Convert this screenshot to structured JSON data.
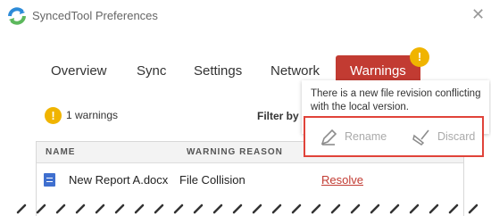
{
  "window": {
    "title": "SyncedTool Preferences",
    "close_glyph": "✕"
  },
  "tabs": [
    {
      "label": "Overview",
      "active": false
    },
    {
      "label": "Sync",
      "active": false
    },
    {
      "label": "Settings",
      "active": false
    },
    {
      "label": "Network",
      "active": false
    },
    {
      "label": "Warnings",
      "active": true
    }
  ],
  "tab_badge": {
    "glyph": "!",
    "icon": "warning-badge-icon",
    "color": "#f0b400"
  },
  "summary": {
    "icon_glyph": "!",
    "count_text": "1 warnings",
    "filter_label": "Filter by"
  },
  "table": {
    "headers": [
      "NAME",
      "WARNING REASON"
    ],
    "rows": [
      {
        "icon": "document-icon",
        "name": "New Report A.docx",
        "reason": "File Collision",
        "action": "Resolve"
      }
    ]
  },
  "popup": {
    "message": "There is a new file revision conflicting with the local version.",
    "actions": [
      {
        "label": "Rename",
        "icon": "pencil-icon"
      },
      {
        "label": "Discard",
        "icon": "broom-icon"
      }
    ]
  },
  "colors": {
    "accent": "#c23b32",
    "warning": "#f0b400",
    "highlight": "#e0433a",
    "doc_icon": "#3f6fcf"
  }
}
